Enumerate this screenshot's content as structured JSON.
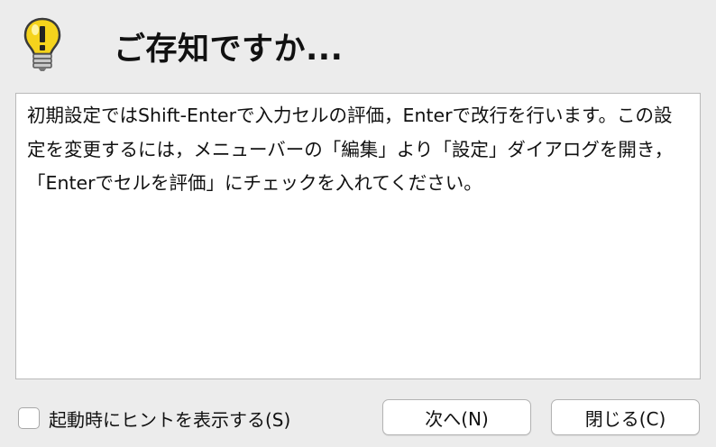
{
  "dialog": {
    "icon": "lightbulb-icon",
    "title": "ご存知ですか...",
    "message": "初期設定ではShift-Enterで入力セルの評価，Enterで改行を行います。この設定を変更するには，メニューバーの「編集」より「設定」ダイアログを開き，「Enterでセルを評価」にチェックを入れてください。",
    "show_at_startup": {
      "label": "起動時にヒントを表示する(S)",
      "checked": false
    },
    "buttons": {
      "next": "次へ(N)",
      "close": "閉じる(C)"
    }
  },
  "colors": {
    "window_bg": "#ececec",
    "bulb_yellow": "#f5d31c",
    "text": "#111111"
  }
}
